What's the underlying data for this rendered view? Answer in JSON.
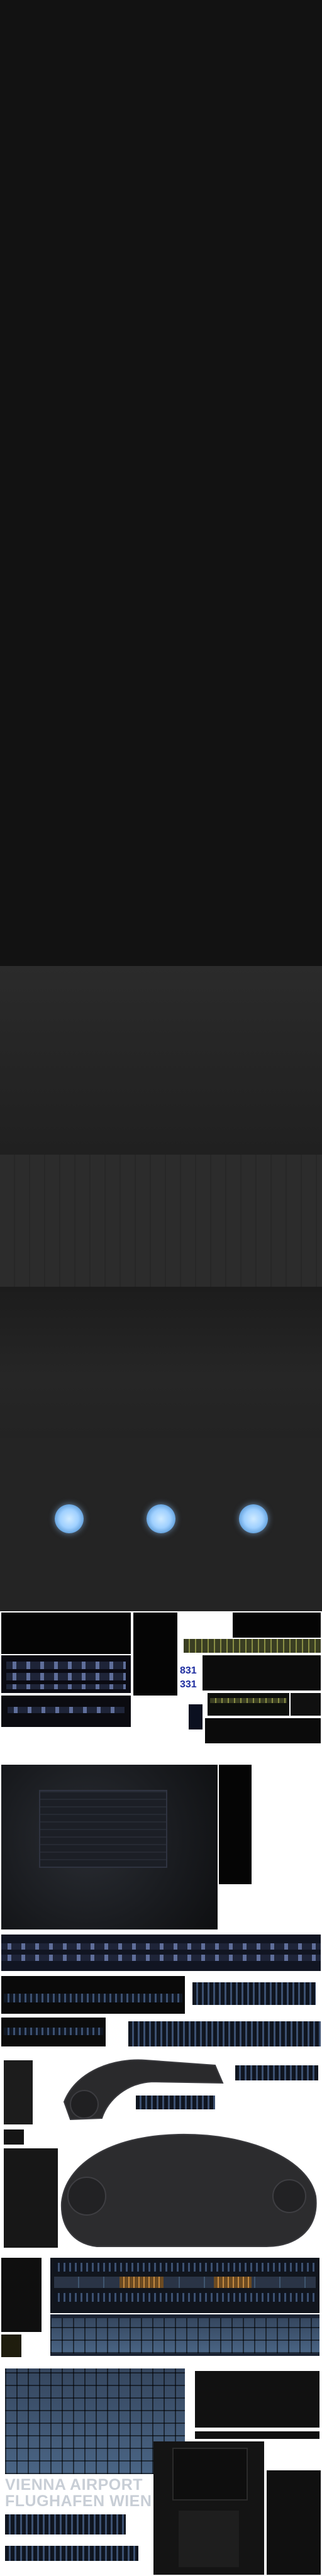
{
  "atlas": {
    "gate_number_top": "831",
    "gate_number_bottom": "331",
    "sign_line_1": "VIENNA AIRPORT",
    "sign_line_2": "FLUGHAFEN WIEN"
  }
}
